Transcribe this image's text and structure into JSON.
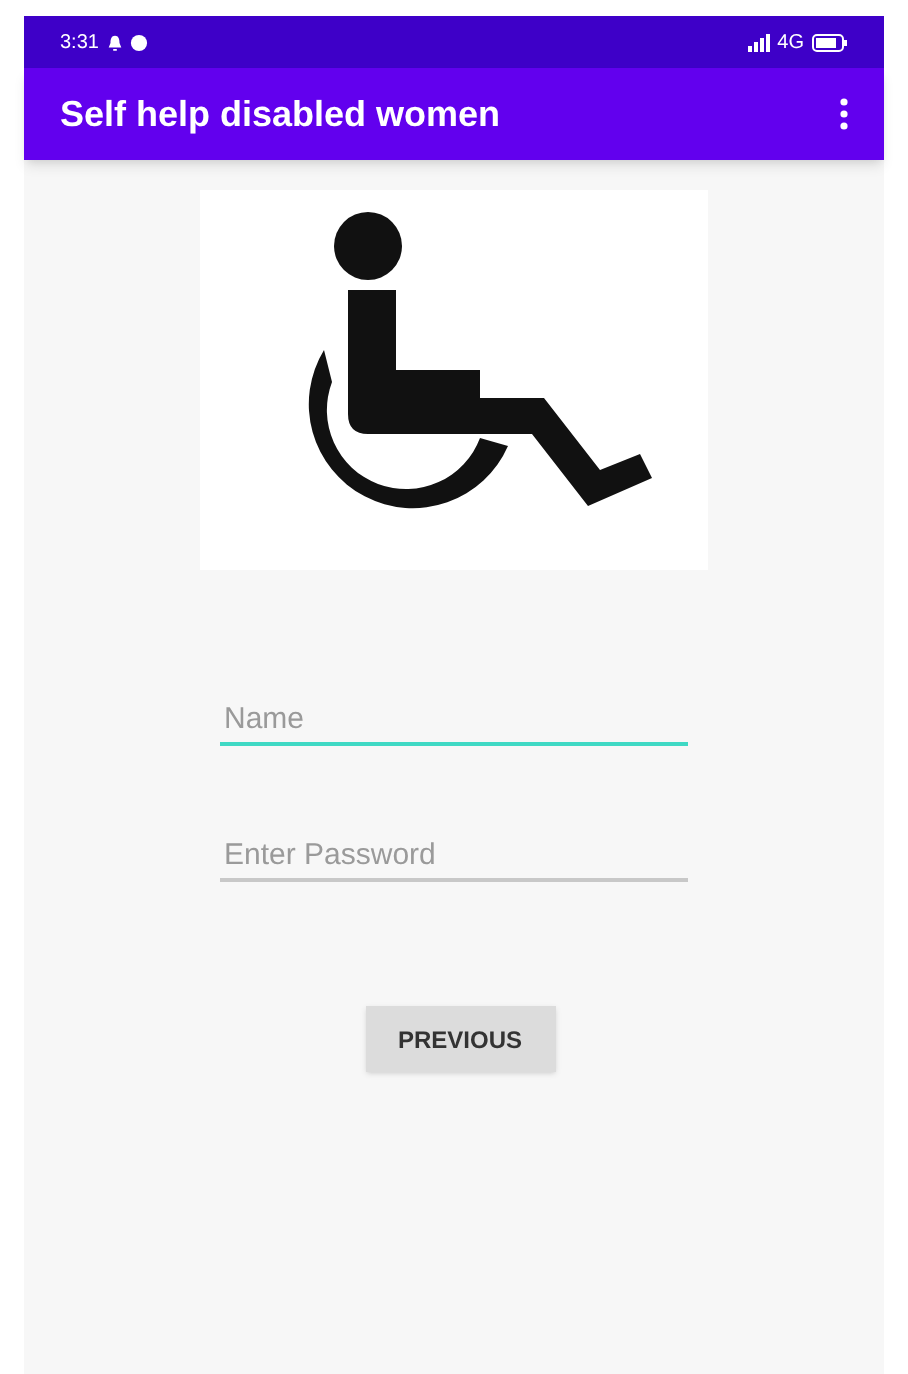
{
  "status_bar": {
    "time": "3:31",
    "network": "4G"
  },
  "app_bar": {
    "title": "Self help disabled women"
  },
  "form": {
    "fields": [
      {
        "placeholder": "Name",
        "focused": true
      },
      {
        "placeholder": "Enter Password",
        "focused": false
      }
    ],
    "button": "PREVIOUS"
  }
}
